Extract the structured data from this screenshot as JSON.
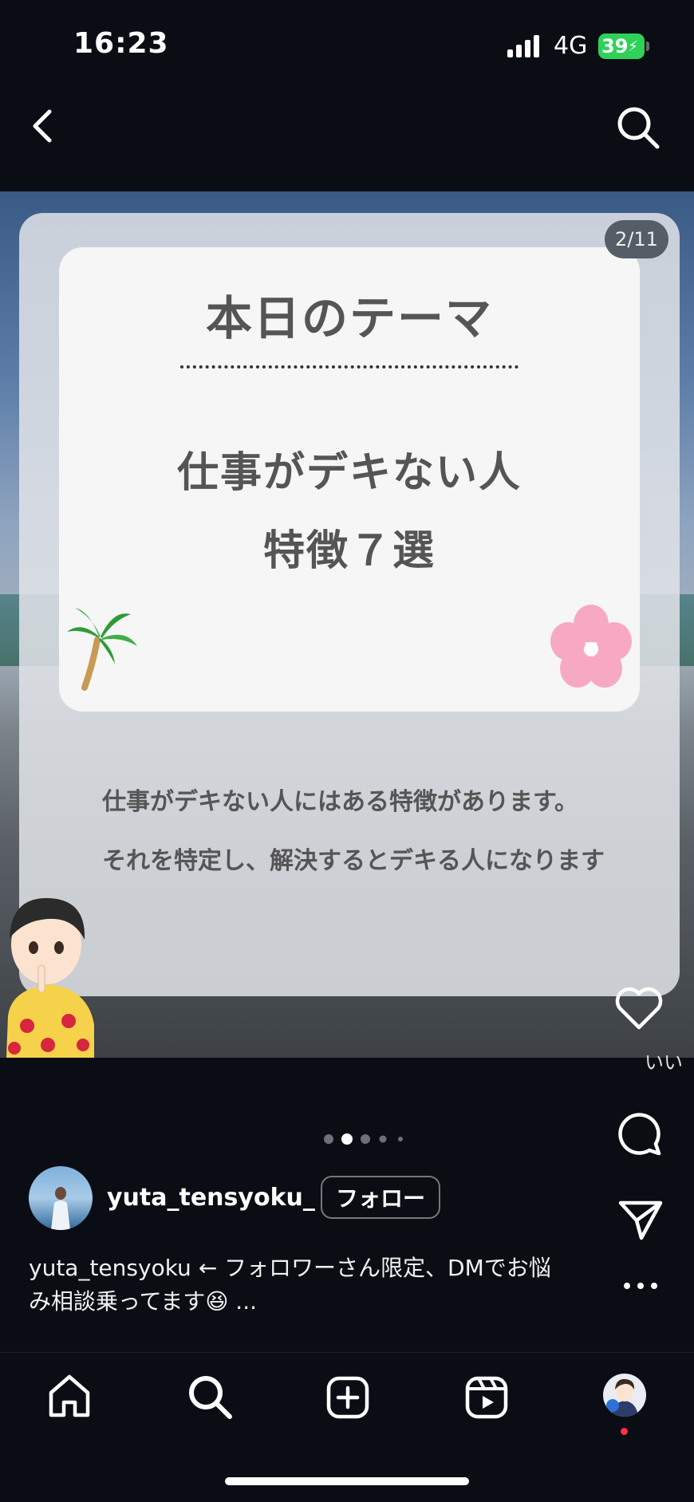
{
  "status_bar": {
    "time": "16:23",
    "network": "4G",
    "battery": "39"
  },
  "post": {
    "page_counter": "2/11",
    "slide": {
      "title": "本日のテーマ",
      "subtitle_line1": "仕事がデキない人",
      "subtitle_line2": "特徴７選",
      "body_line1": "仕事がデキない人にはある特徴があります。",
      "body_line2": "それを特定し、解決するとデキる人になります"
    },
    "like_label": "いい"
  },
  "carousel": {
    "active_index": 1,
    "count": 5
  },
  "account": {
    "username": "yuta_tensyoku_",
    "follow_label": "フォロー"
  },
  "caption": {
    "line1": "yuta_tensyoku ← フォロワーさん限定、DMでお悩",
    "line2": "み相談乗ってます😆 ..."
  },
  "icons": [
    "back-icon",
    "search-icon",
    "heart-icon",
    "comment-icon",
    "share-icon",
    "more-icon",
    "home-icon",
    "create-icon",
    "reels-icon",
    "profile-icon"
  ],
  "colors": {
    "background": "#0b0d14",
    "battery": "#2fd158",
    "notification_dot": "#ff3040",
    "flower": "#f7a9c4",
    "palm": "#2f9a3c"
  }
}
